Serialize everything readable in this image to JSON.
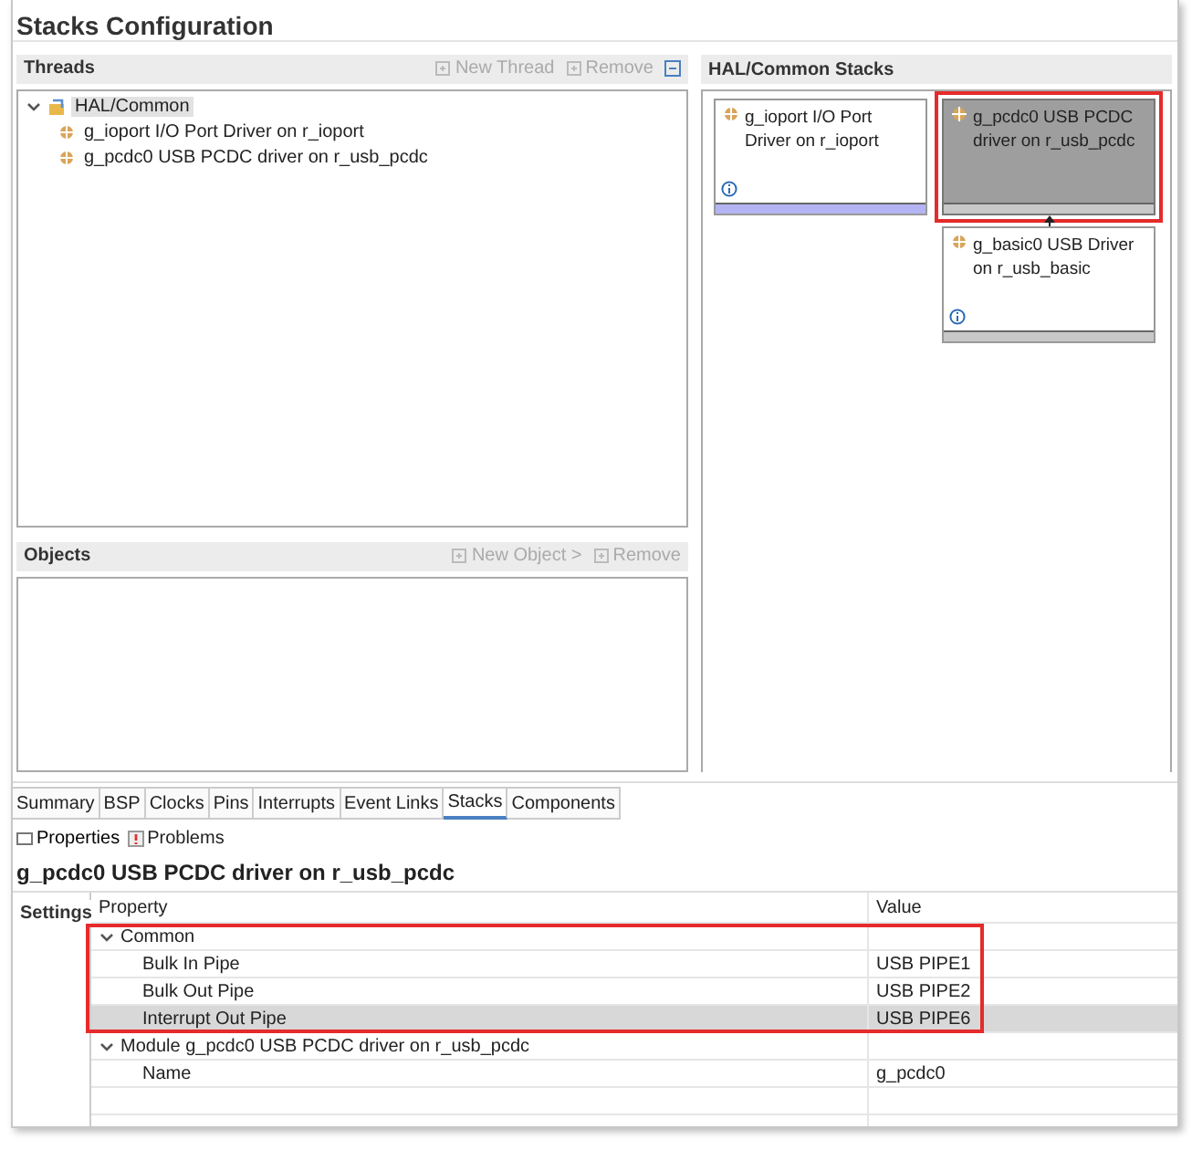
{
  "title": "Stacks Configuration",
  "threads": {
    "title": "Threads",
    "actions": [
      {
        "label": "New Thread",
        "disabled": true
      },
      {
        "label": "Remove",
        "disabled": true
      }
    ],
    "tree": [
      {
        "label": "HAL/Common",
        "expanded": true,
        "selected": true,
        "children": [
          {
            "label": "g_ioport I/O Port Driver on r_ioport"
          },
          {
            "label": "g_pcdc0 USB PCDC driver on r_usb_pcdc"
          }
        ]
      }
    ]
  },
  "objects": {
    "title": "Objects",
    "actions": [
      {
        "label": "New Object >",
        "disabled": true
      },
      {
        "label": "Remove",
        "disabled": true
      }
    ]
  },
  "stacks": {
    "title": "HAL/Common Stacks",
    "modules": [
      {
        "label": "g_ioport I/O Port Driver on r_ioport",
        "selected": false,
        "highlighted": false,
        "color": "#b4b4f4"
      },
      {
        "label": "g_pcdc0 USB PCDC driver on r_usb_pcdc",
        "selected": true,
        "highlighted": true,
        "color": "#c8c8c8",
        "children": [
          {
            "label": "g_basic0 USB Driver on r_usb_basic",
            "selected": false,
            "highlighted": false,
            "color": "#c8c8c8"
          }
        ]
      }
    ]
  },
  "tabs": [
    {
      "label": "Summary",
      "selected": false
    },
    {
      "label": "BSP",
      "selected": false
    },
    {
      "label": "Clocks",
      "selected": false
    },
    {
      "label": "Pins",
      "selected": false
    },
    {
      "label": "Interrupts",
      "selected": false
    },
    {
      "label": "Event Links",
      "selected": false
    },
    {
      "label": "Stacks",
      "selected": true
    },
    {
      "label": "Components",
      "selected": false
    }
  ],
  "views": [
    {
      "label": "Properties",
      "selected": true
    },
    {
      "label": "Problems",
      "selected": false
    }
  ],
  "properties": {
    "title": "g_pcdc0 USB PCDC driver on r_usb_pcdc",
    "side_tabs": [
      {
        "label": "Settings",
        "selected": true
      }
    ],
    "columns": [
      "Property",
      "Value"
    ],
    "rows": [
      {
        "label": "Common",
        "expanded": true,
        "highlighted": true,
        "children": [
          {
            "label": "Bulk In Pipe",
            "value": "USB PIPE1",
            "selected": false
          },
          {
            "label": "Bulk Out Pipe",
            "value": "USB PIPE2",
            "selected": false
          },
          {
            "label": "Interrupt Out Pipe",
            "value": "USB PIPE6",
            "selected": true
          }
        ]
      },
      {
        "label": "Module g_pcdc0 USB PCDC driver on r_usb_pcdc",
        "expanded": true,
        "highlighted": false,
        "children": [
          {
            "label": "Name",
            "value": "g_pcdc0",
            "selected": false
          }
        ]
      }
    ]
  }
}
